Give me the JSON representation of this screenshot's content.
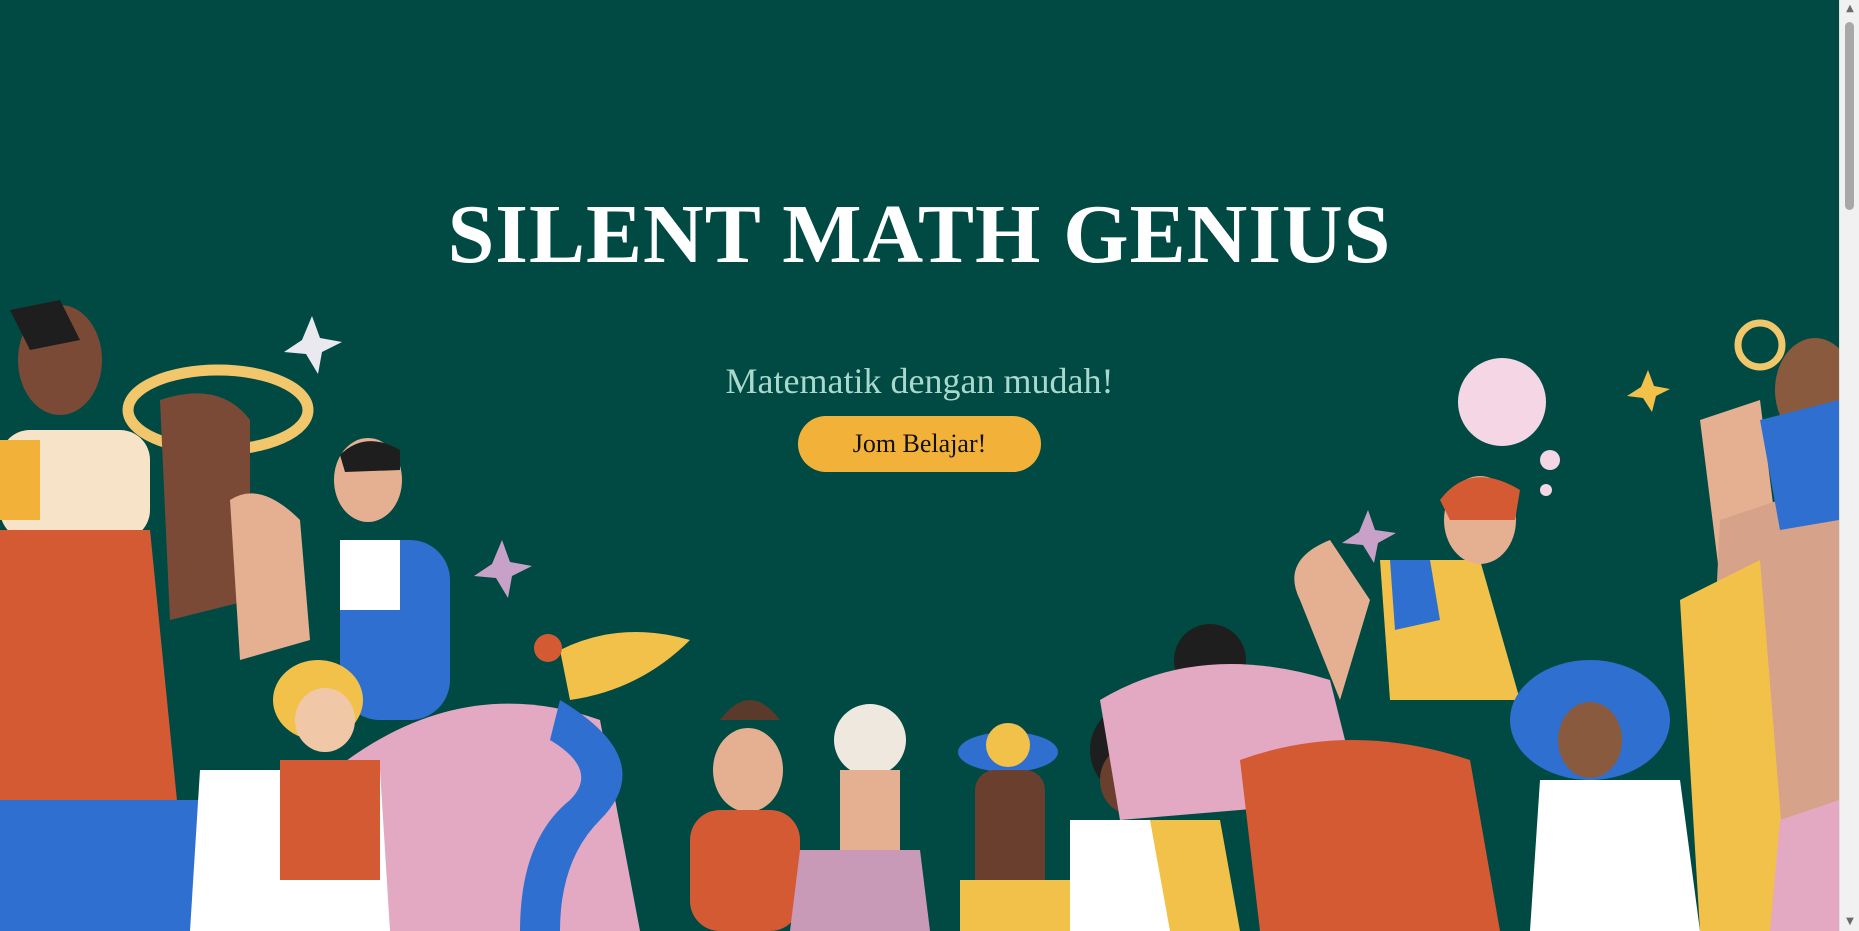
{
  "hero": {
    "title": "SILENT MATH GENIUS",
    "subtitle": "Matematik dengan mudah!",
    "cta_label": "Jom Belajar!"
  },
  "scrollbar": {
    "up_icon": "▲",
    "down_icon": "▼"
  },
  "colors": {
    "background": "#014a44",
    "title": "#ffffff",
    "subtitle": "#a9d9cc",
    "button": "#f2b23a"
  }
}
